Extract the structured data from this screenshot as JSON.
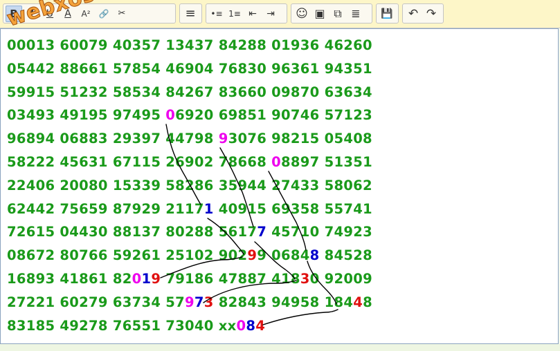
{
  "toolbar": {
    "groups": [
      {
        "name": "format",
        "buttons": [
          {
            "icon": "bold-icon",
            "glyph": "B"
          },
          {
            "icon": "italic-icon",
            "glyph": "I"
          },
          {
            "icon": "underline-icon",
            "glyph": "U"
          },
          {
            "icon": "text-color-icon",
            "glyph": "A"
          },
          {
            "icon": "font-size-icon",
            "glyph": "A²"
          },
          {
            "icon": "link-icon",
            "glyph": "🔗"
          },
          {
            "icon": "unlink-icon",
            "glyph": "✂"
          }
        ]
      },
      {
        "name": "align",
        "buttons": [
          {
            "icon": "align-left-icon",
            "glyph": "≡"
          }
        ]
      },
      {
        "name": "lists",
        "buttons": [
          {
            "icon": "bullet-list-icon",
            "glyph": "•≡"
          },
          {
            "icon": "numbered-list-icon",
            "glyph": "1≡"
          },
          {
            "icon": "outdent-icon",
            "glyph": "⇤"
          },
          {
            "icon": "indent-icon",
            "glyph": "⇥"
          }
        ]
      },
      {
        "name": "insert",
        "buttons": [
          {
            "icon": "smiley-icon",
            "glyph": "☺"
          },
          {
            "icon": "image-icon",
            "glyph": "▣"
          },
          {
            "icon": "gallery-icon",
            "glyph": "⧉"
          },
          {
            "icon": "page-icon",
            "glyph": "≣"
          }
        ]
      },
      {
        "name": "save",
        "buttons": [
          {
            "icon": "save-icon",
            "glyph": "💾"
          }
        ]
      },
      {
        "name": "history",
        "buttons": [
          {
            "icon": "undo-icon",
            "glyph": "↶"
          },
          {
            "icon": "redo-icon",
            "glyph": "↷"
          }
        ]
      }
    ]
  },
  "watermark": "webxoso.net",
  "lines": [
    [
      {
        "t": "00013 60079 40357 13437 84288 01936 46260",
        "c": "g"
      }
    ],
    [
      {
        "t": "05442 88661 57854 46904 76830 96361 94351",
        "c": "g"
      }
    ],
    [
      {
        "t": "59915 51232 58534 84267 83660 09870 63634",
        "c": "g"
      }
    ],
    [
      {
        "t": "03493 49195 97495 ",
        "c": "g"
      },
      {
        "t": "0",
        "c": "m"
      },
      {
        "t": "6920 69851 90746 57123",
        "c": "g"
      }
    ],
    [
      {
        "t": "96894 06883 29397 44798 ",
        "c": "g"
      },
      {
        "t": "9",
        "c": "m"
      },
      {
        "t": "3076 98215 05408",
        "c": "g"
      }
    ],
    [
      {
        "t": "58222 45631 67115 26902 78668 ",
        "c": "g"
      },
      {
        "t": "0",
        "c": "m"
      },
      {
        "t": "8897 51351",
        "c": "g"
      }
    ],
    [
      {
        "t": "22406 20080 15339 58286 35944 27433 58062",
        "c": "g"
      }
    ],
    [
      {
        "t": "62442 75659 87929 2117",
        "c": "g"
      },
      {
        "t": "1",
        "c": "b"
      },
      {
        "t": " 40915 69358 55741",
        "c": "g"
      }
    ],
    [
      {
        "t": "72615 04430 88137 80288 5617",
        "c": "g"
      },
      {
        "t": "7",
        "c": "b"
      },
      {
        "t": " 45710 74923",
        "c": "g"
      }
    ],
    [
      {
        "t": "08672 80766 59261 25102 902",
        "c": "g"
      },
      {
        "t": "9",
        "c": "r"
      },
      {
        "t": "9 0684",
        "c": "g"
      },
      {
        "t": "8",
        "c": "b"
      },
      {
        "t": " 84528",
        "c": "g"
      }
    ],
    [
      {
        "t": "16893 41861 82",
        "c": "g"
      },
      {
        "t": "0",
        "c": "m"
      },
      {
        "t": "1",
        "c": "b"
      },
      {
        "t": "9",
        "c": "r"
      },
      {
        "t": " 79186 47887 418",
        "c": "g"
      },
      {
        "t": "3",
        "c": "r"
      },
      {
        "t": "0 92009",
        "c": "g"
      }
    ],
    [
      {
        "t": "27221 60279 63734 57",
        "c": "g"
      },
      {
        "t": "9",
        "c": "m"
      },
      {
        "t": "7",
        "c": "b"
      },
      {
        "t": "3",
        "c": "r"
      },
      {
        "t": " 82843 94958 184",
        "c": "g"
      },
      {
        "t": "4",
        "c": "r"
      },
      {
        "t": "8",
        "c": "g"
      }
    ],
    [
      {
        "t": "83185 49278 76551 73040 xx",
        "c": "g"
      },
      {
        "t": "0",
        "c": "m"
      },
      {
        "t": "8",
        "c": "b"
      },
      {
        "t": "4",
        "c": "r"
      }
    ]
  ],
  "colors": {
    "green": "#1a9a1a",
    "magenta": "#ee00ee",
    "blue": "#0000cc",
    "red": "#e01010"
  }
}
